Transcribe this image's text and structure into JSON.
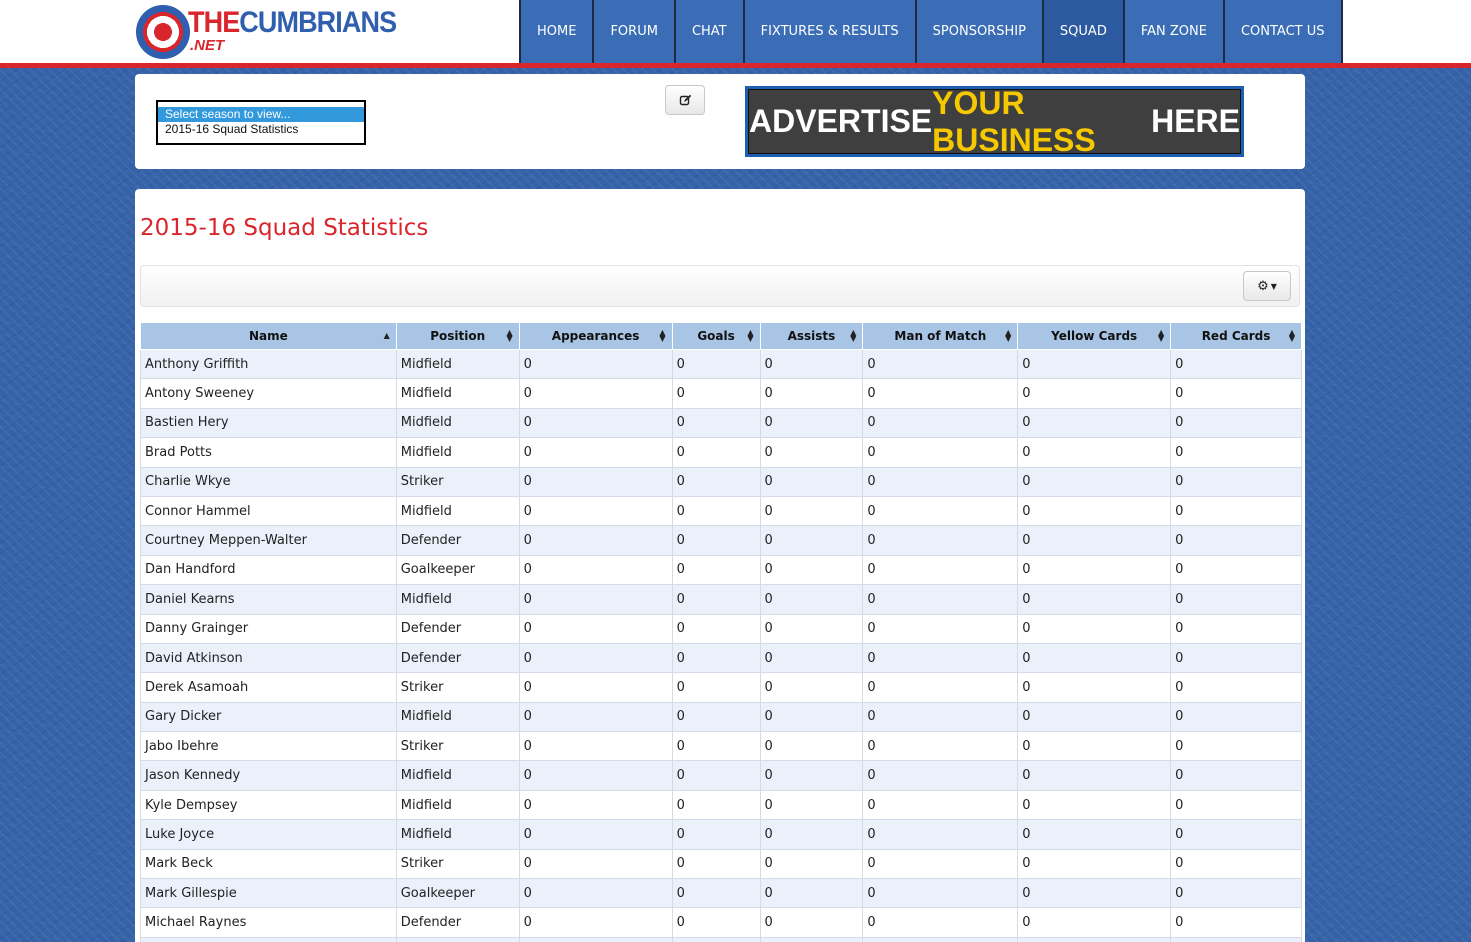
{
  "site": {
    "logo_the": "THE",
    "logo_cumbrians": "CUMBRIANS",
    "logo_net": ".NET"
  },
  "nav": {
    "items": [
      {
        "label": "HOME"
      },
      {
        "label": "FORUM"
      },
      {
        "label": "CHAT"
      },
      {
        "label": "FIXTURES & RESULTS"
      },
      {
        "label": "SPONSORSHIP"
      },
      {
        "label": "SQUAD",
        "active": true
      },
      {
        "label": "FAN ZONE"
      },
      {
        "label": "CONTACT US"
      }
    ]
  },
  "season_select": {
    "options": [
      "Select season to view...",
      "2015-16 Squad Statistics"
    ]
  },
  "ad": {
    "part1": "ADVERTISE ",
    "part2": "YOUR BUSINESS",
    "part3": " HERE"
  },
  "page": {
    "title": "2015-16 Squad Statistics"
  },
  "table": {
    "columns": [
      "Name",
      "Position",
      "Appearances",
      "Goals",
      "Assists",
      "Man of Match",
      "Yellow Cards",
      "Red Cards"
    ],
    "rows": [
      [
        "Anthony Griffith",
        "Midfield",
        "0",
        "0",
        "0",
        "0",
        "0",
        "0"
      ],
      [
        "Antony Sweeney",
        "Midfield",
        "0",
        "0",
        "0",
        "0",
        "0",
        "0"
      ],
      [
        "Bastien Hery",
        "Midfield",
        "0",
        "0",
        "0",
        "0",
        "0",
        "0"
      ],
      [
        "Brad Potts",
        "Midfield",
        "0",
        "0",
        "0",
        "0",
        "0",
        "0"
      ],
      [
        "Charlie Wkye",
        "Striker",
        "0",
        "0",
        "0",
        "0",
        "0",
        "0"
      ],
      [
        "Connor Hammel",
        "Midfield",
        "0",
        "0",
        "0",
        "0",
        "0",
        "0"
      ],
      [
        "Courtney Meppen-Walter",
        "Defender",
        "0",
        "0",
        "0",
        "0",
        "0",
        "0"
      ],
      [
        "Dan Handford",
        "Goalkeeper",
        "0",
        "0",
        "0",
        "0",
        "0",
        "0"
      ],
      [
        "Daniel Kearns",
        "Midfield",
        "0",
        "0",
        "0",
        "0",
        "0",
        "0"
      ],
      [
        "Danny Grainger",
        "Defender",
        "0",
        "0",
        "0",
        "0",
        "0",
        "0"
      ],
      [
        "David Atkinson",
        "Defender",
        "0",
        "0",
        "0",
        "0",
        "0",
        "0"
      ],
      [
        "Derek Asamoah",
        "Striker",
        "0",
        "0",
        "0",
        "0",
        "0",
        "0"
      ],
      [
        "Gary Dicker",
        "Midfield",
        "0",
        "0",
        "0",
        "0",
        "0",
        "0"
      ],
      [
        "Jabo Ibehre",
        "Striker",
        "0",
        "0",
        "0",
        "0",
        "0",
        "0"
      ],
      [
        "Jason Kennedy",
        "Midfield",
        "0",
        "0",
        "0",
        "0",
        "0",
        "0"
      ],
      [
        "Kyle Dempsey",
        "Midfield",
        "0",
        "0",
        "0",
        "0",
        "0",
        "0"
      ],
      [
        "Luke Joyce",
        "Midfield",
        "0",
        "0",
        "0",
        "0",
        "0",
        "0"
      ],
      [
        "Mark Beck",
        "Striker",
        "0",
        "0",
        "0",
        "0",
        "0",
        "0"
      ],
      [
        "Mark Gillespie",
        "Goalkeeper",
        "0",
        "0",
        "0",
        "0",
        "0",
        "0"
      ],
      [
        "Michael Raynes",
        "Defender",
        "0",
        "0",
        "0",
        "0",
        "0",
        "0"
      ],
      [
        "",
        "",
        "",
        "",
        "",
        "",
        "",
        ""
      ]
    ]
  },
  "colors": {
    "brand_red": "#d9262c",
    "brand_blue": "#3a6db5",
    "header_row": "#a9c5e6"
  }
}
